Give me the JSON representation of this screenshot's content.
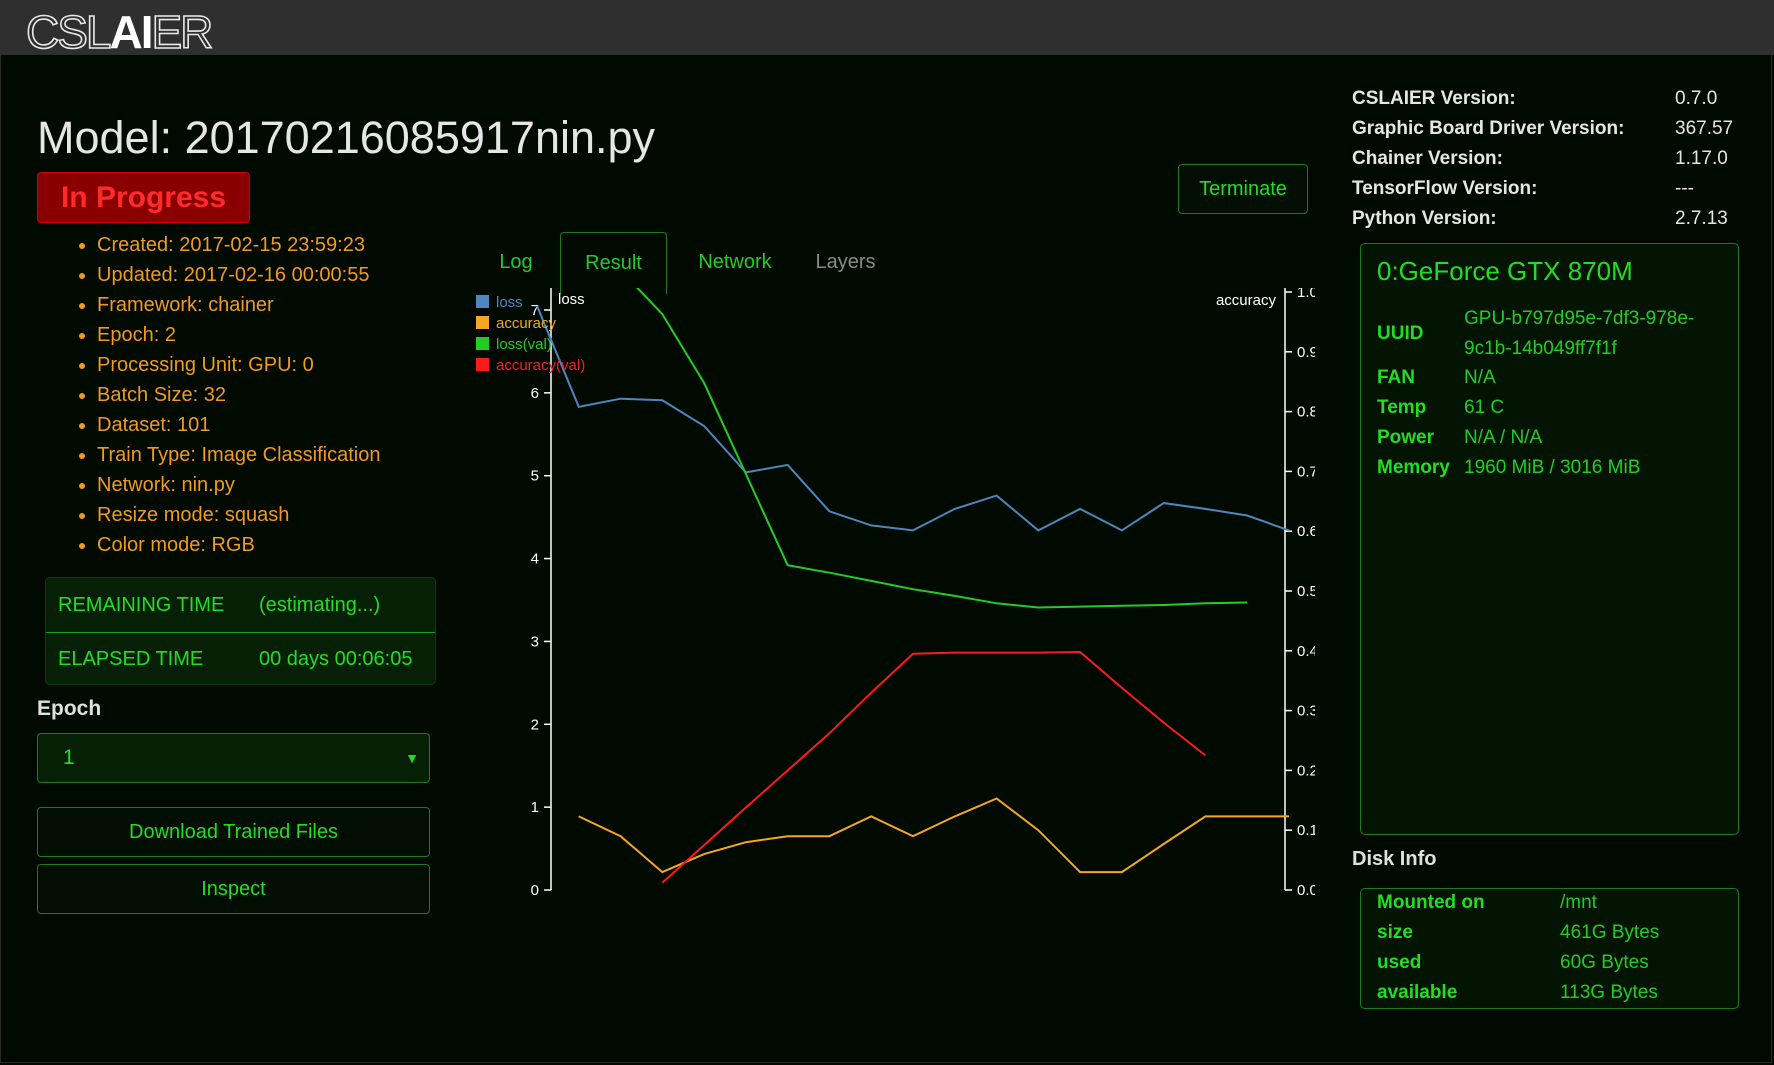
{
  "app": {
    "logo_prefix": "CSL",
    "logo_ai": "AI",
    "logo_suffix": "ER"
  },
  "model": {
    "title": "Model: 20170216085917nin.py",
    "status": "In Progress",
    "info": [
      "Created: 2017-02-15 23:59:23",
      "Updated: 2017-02-16 00:00:55",
      "Framework: chainer",
      "Epoch: 2",
      "Processing Unit: GPU: 0",
      "Batch Size: 32",
      "Dataset: 101",
      "Train Type: Image Classification",
      "Network: nin.py",
      "Resize mode: squash",
      "Color mode: RGB"
    ]
  },
  "timing": {
    "remaining_label": "REMAINING TIME",
    "remaining_value": "(estimating...)",
    "elapsed_label": "ELAPSED TIME",
    "elapsed_value": "00 days 00:06:05"
  },
  "controls": {
    "epoch_label": "Epoch",
    "epoch_selected": "1",
    "download_label": "Download Trained Files",
    "inspect_label": "Inspect",
    "terminate_label": "Terminate"
  },
  "tabs": [
    {
      "label": "Log",
      "active": false
    },
    {
      "label": "Result",
      "active": true
    },
    {
      "label": "Network",
      "active": false
    },
    {
      "label": "Layers",
      "active": false
    }
  ],
  "chart_data": {
    "type": "line",
    "left_axis_label": "loss",
    "right_axis_label": "accuracy",
    "left_ylim": [
      0,
      7
    ],
    "right_ylim": [
      0,
      1.0
    ],
    "left_ticks": [
      "0",
      "1",
      "2",
      "3",
      "4",
      "5",
      "6",
      "7"
    ],
    "right_ticks": [
      "0.0",
      "0.1",
      "0.2",
      "0.3",
      "0.4",
      "0.5",
      "0.6",
      "0.7",
      "0.8",
      "0.9",
      "1.0"
    ],
    "x": [
      1,
      2,
      3,
      4,
      5,
      6,
      7,
      8,
      9,
      10,
      11,
      12,
      13,
      14,
      15,
      16,
      17,
      18
    ],
    "xlim": [
      0,
      18
    ],
    "series": [
      {
        "name": "loss",
        "axis": "left",
        "color": "#4f86c0",
        "x": [
          0,
          1,
          2,
          3,
          4,
          5,
          6,
          7,
          8,
          9,
          10,
          11,
          12,
          13,
          14,
          15,
          16,
          17,
          18
        ],
        "values": [
          7.05,
          5.83,
          5.93,
          5.91,
          5.6,
          5.04,
          5.13,
          4.57,
          4.4,
          4.34,
          4.6,
          4.76,
          4.34,
          4.6,
          4.34,
          4.67,
          4.6,
          4.52,
          4.34
        ]
      },
      {
        "name": "accuracy",
        "axis": "right",
        "color": "#f5a623",
        "x": [
          1,
          2,
          3,
          4,
          5,
          6,
          7,
          8,
          9,
          10,
          11,
          12,
          13,
          14,
          15,
          16,
          17,
          18
        ],
        "values": [
          0.123,
          0.09,
          0.03,
          0.06,
          0.08,
          0.09,
          0.09,
          0.123,
          0.09,
          0.123,
          0.153,
          0.1,
          0.03,
          0.03,
          0.077,
          0.123,
          0.123,
          0.123
        ]
      },
      {
        "name": "loss(val)",
        "axis": "left",
        "color": "#22cc22",
        "x": [
          2,
          3,
          4,
          5,
          6,
          7,
          8,
          9,
          10,
          11,
          12,
          13,
          14,
          15,
          16,
          17
        ],
        "values": [
          7.48,
          6.95,
          6.12,
          5.02,
          3.92,
          3.83,
          3.73,
          3.63,
          3.55,
          3.46,
          3.41,
          3.42,
          3.43,
          3.44,
          3.46,
          3.47
        ]
      },
      {
        "name": "accuracy(val)",
        "axis": "right",
        "color": "#ff1a1a",
        "x": [
          3,
          4,
          5,
          6,
          7,
          8,
          9,
          10,
          11,
          12,
          13,
          14,
          15,
          16
        ],
        "values": [
          0.012,
          0.075,
          0.138,
          0.2,
          0.262,
          0.33,
          0.395,
          0.397,
          0.397,
          0.397,
          0.398,
          0.338,
          0.28,
          0.225
        ]
      }
    ]
  },
  "versions": [
    {
      "key": "CSLAIER Version:",
      "value": "0.7.0"
    },
    {
      "key": "Graphic Board Driver Version:",
      "value": "367.57"
    },
    {
      "key": "Chainer Version:",
      "value": "1.17.0"
    },
    {
      "key": "TensorFlow Version:",
      "value": "---"
    },
    {
      "key": "Python Version:",
      "value": "2.7.13"
    }
  ],
  "gpu": {
    "name": "0:GeForce GTX 870M",
    "uuid_label": "UUID",
    "uuid_value": "GPU-b797d95e-7df3-978e-9c1b-14b049ff7f1f",
    "fan_label": "FAN",
    "fan_value": "N/A",
    "temp_label": "Temp",
    "temp_value": "61 C",
    "power_label": "Power",
    "power_value": "N/A / N/A",
    "memory_label": "Memory",
    "memory_value": "1960 MiB / 3016 MiB"
  },
  "disk": {
    "title": "Disk Info",
    "rows": [
      {
        "key": "Mounted on",
        "value": "/mnt"
      },
      {
        "key": "size",
        "value": "461G Bytes"
      },
      {
        "key": "used",
        "value": "60G Bytes"
      },
      {
        "key": "available",
        "value": "113G Bytes"
      }
    ]
  }
}
